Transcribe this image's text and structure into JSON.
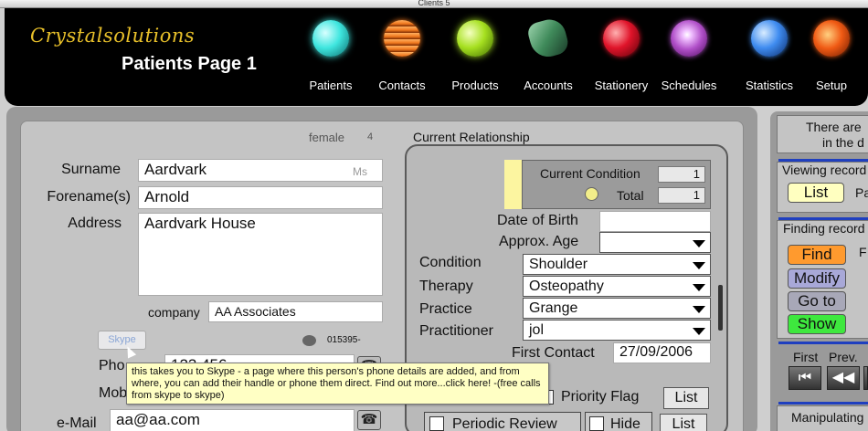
{
  "window": {
    "title": "Clients 5"
  },
  "header": {
    "brand": "Crystalsolutions",
    "page_title": "Patients Page 1",
    "nav": [
      {
        "label": "Patients",
        "icon": "patients-orb-icon",
        "color": "#3fe6df"
      },
      {
        "label": "Contacts",
        "icon": "contacts-orb-icon",
        "color": "#f0781e"
      },
      {
        "label": "Products",
        "icon": "products-orb-icon",
        "color": "#a6e020"
      },
      {
        "label": "Accounts",
        "icon": "accounts-gem-icon",
        "color": "#3f8a5a"
      },
      {
        "label": "Stationery",
        "icon": "stationery-orb-icon",
        "color": "#e0142a"
      },
      {
        "label": "Schedules",
        "icon": "schedules-orb-icon",
        "color": "#b04fc8"
      },
      {
        "label": "Statistics",
        "icon": "statistics-orb-icon",
        "color": "#3f8cf0"
      },
      {
        "label": "Setup",
        "icon": "setup-orb-icon",
        "color": "#f05a14"
      }
    ]
  },
  "patient": {
    "gender": "female",
    "gender_num": "4",
    "surname_label": "Surname",
    "surname": "Aardvark",
    "title": "Ms",
    "forename_label": "Forename(s)",
    "forename": "Arnold",
    "address_label": "Address",
    "address": "Aardvark House",
    "company_label": "company",
    "company": "AA Associates",
    "skype_label": "Skype",
    "phone_ref": "015395-",
    "phone_label": "Pho",
    "phone_value": "123 456",
    "mobile_label": "Mob",
    "email_label": "e-Mail",
    "email": "aa@aa.com"
  },
  "tooltip": {
    "text": "this takes you to Skype - a page where this person's phone details are added, and from where, you can add their handle or phone them direct. Find out more...click here! -(free calls from skype to skype)"
  },
  "relationship": {
    "title": "Current Relationship",
    "current_condition_label": "Current Condition",
    "current_condition_count": "1",
    "total_label": "Total",
    "total_count": "1",
    "dob_label": "Date of Birth",
    "dob": "",
    "age_label": "Approx. Age",
    "age": "",
    "condition_label": "Condition",
    "condition": "Shoulder",
    "therapy_label": "Therapy",
    "therapy": "Osteopathy",
    "practice_label": "Practice",
    "practice": "Grange",
    "practitioner_label": "Practitioner",
    "practitioner": "jol",
    "first_contact_label": "First Contact",
    "first_contact": "27/09/2006",
    "priority_flag_label": "Priority Flag",
    "list_label": "List",
    "periodic_review_label": "Periodic Review",
    "hide_label": "Hide",
    "list2_label": "List"
  },
  "sidebar": {
    "info_line1": "There are",
    "info_line2": "in the d",
    "viewing_title": "Viewing record",
    "list_button": "List",
    "list_after": "Pa",
    "finding_title": "Finding record",
    "find_button": "Find",
    "find_after": "F",
    "modify_button": "Modify",
    "goto_button": "Go to",
    "show_button": "Show",
    "first_label": "First",
    "prev_label": "Prev.",
    "first_arrow": "⏮",
    "prev_arrow": "◀◀",
    "manipulating_title": "Manipulating"
  },
  "colors": {
    "find_button": "#ff9a2e",
    "modify_button": "#a8a8d8",
    "goto_button": "#a8a8b8",
    "show_button": "#3ee83e",
    "list_button": "#ffffc0",
    "brand": "#e8c02a"
  }
}
